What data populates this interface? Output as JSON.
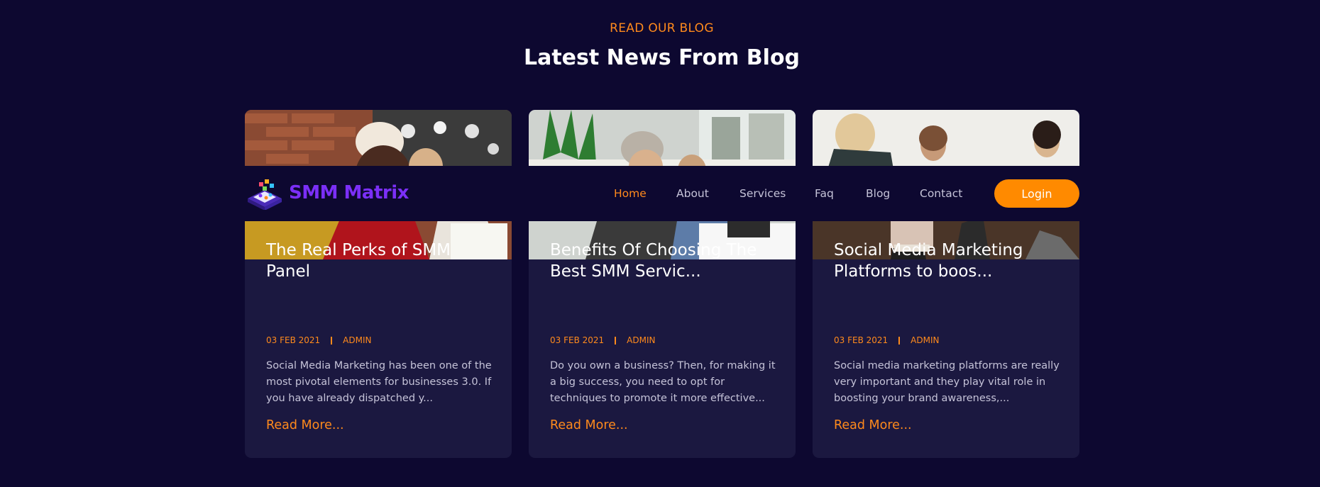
{
  "section": {
    "kicker": "READ OUR BLOG",
    "title": "Latest News From Blog"
  },
  "navbar": {
    "logo_text": "SMM Matrix",
    "links": [
      {
        "label": "Home",
        "active": true
      },
      {
        "label": "About",
        "active": false
      },
      {
        "label": "Services",
        "active": false
      },
      {
        "label": "Faq",
        "active": false
      },
      {
        "label": "Blog",
        "active": false
      },
      {
        "label": "Contact",
        "active": false
      }
    ],
    "login_label": "Login"
  },
  "posts": [
    {
      "title": "The Real Perks of SMM Panel",
      "date": "03 FEB 2021",
      "author": "ADMIN",
      "excerpt": "Social Media Marketing has been one of the most pivotal elements for businesses 3.0. If you have already dispatched y...",
      "link": "Read More..."
    },
    {
      "title": "Benefits Of Choosing The Best SMM Servic...",
      "date": "03 FEB 2021",
      "author": "ADMIN",
      "excerpt": "Do you own a business? Then, for making it a big success, you need to opt for techniques to promote it more effective...",
      "link": "Read More..."
    },
    {
      "title": "Social Media Marketing Platforms to boos...",
      "date": "03 FEB 2021",
      "author": "ADMIN",
      "excerpt": "Social media marketing platforms are really very important and they play vital role in boosting your brand awareness,...",
      "link": "Read More..."
    }
  ],
  "colors": {
    "background": "#0d0830",
    "card": "#1b1840",
    "accent": "#ff8a1c",
    "brand": "#7b2ff7"
  }
}
